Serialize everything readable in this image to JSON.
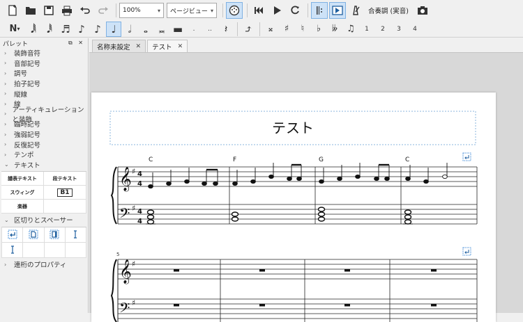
{
  "toolbar": {
    "zoom": "100%",
    "view_mode": "ページビュー",
    "concert_pitch": "合奏調 (実音)"
  },
  "note_toolbar": {
    "voice_numbers": [
      "1",
      "2",
      "3",
      "4"
    ]
  },
  "palette": {
    "title": "パレット",
    "items": [
      "装飾音符",
      "音部記号",
      "調号",
      "拍子記号",
      "縦線",
      "線",
      "アーティキュレーションと装飾",
      "臨時記号",
      "強弱記号",
      "反復記号",
      "テンポ",
      "テキスト"
    ],
    "text_cells": [
      "譜表テキスト",
      "段テキスト",
      "スウィング",
      "B1",
      "楽器",
      ""
    ],
    "section_breaks": "区切りとスペーサー",
    "measure_props": "連桁のプロパティ"
  },
  "tabs": [
    {
      "label": "名称未設定"
    },
    {
      "label": "テスト"
    }
  ],
  "score": {
    "title": "テスト",
    "chords": [
      "C",
      "F",
      "G",
      "C"
    ],
    "system2_measure_number": "5"
  },
  "colors": {
    "accent": "#7fb1e3",
    "active_bg": "#cde2f7",
    "paper": "#ffffff",
    "workspace": "#d8d8d8"
  }
}
